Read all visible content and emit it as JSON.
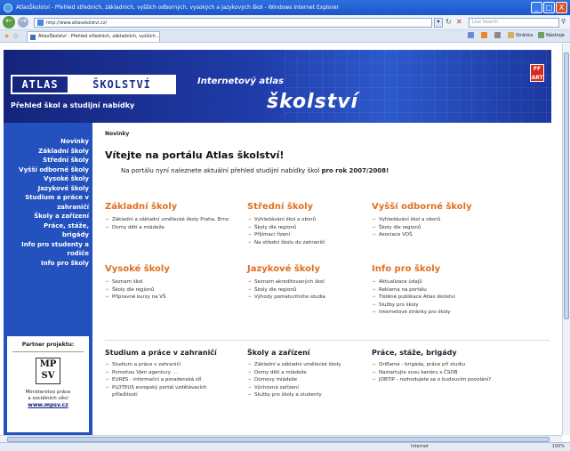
{
  "window": {
    "title": "AtlasŠkolství - Přehled středních, základních, vyšších odborných, vysokých a jazykových škol - Windows Internet Explorer",
    "minimize": "_",
    "maximize": "□",
    "close": "X"
  },
  "address_bar": {
    "url": "http://www.atlasskolstvi.cz/",
    "search_placeholder": "Live Search"
  },
  "tabs": [
    {
      "label": "AtlasŠkolství - Přehled středních, základních, vyšších..."
    }
  ],
  "toolbar": {
    "page_label": "Stránka",
    "tools_label": "Nástroje"
  },
  "banner": {
    "logo_left": "ATLAS",
    "logo_right": "ŠKOLSTVÍ",
    "subtitle": "Přehled škol a studijní nabídky",
    "tagline": "Internetový atlas",
    "big": "školství",
    "partner_logo": "FF ART"
  },
  "sidebar": {
    "items": [
      "Novinky",
      "Základní školy",
      "Střední školy",
      "Vyšší odborné školy",
      "Vysoké školy",
      "Jazykové školy",
      "Studium a práce v",
      "zahraničí",
      "Školy a zařízení",
      "Práce, stáže,",
      "brigády",
      "Info pro studenty a",
      "rodiče",
      "Info pro školy"
    ],
    "partner": {
      "heading": "Partner projektu:",
      "logo_top": "MP",
      "logo_bottom": "SV",
      "name_line1": "Ministerstvo práce",
      "name_line2": "a sociálních věcí",
      "link": "www.mpsv.cz"
    }
  },
  "main": {
    "breadcrumb": "Novinky",
    "welcome": "Vítejte na portálu Atlas školství!",
    "intro_pre": "Na portálu nyní naleznete aktuální přehled studijní nabídky škol",
    "intro_bold": "pro rok 2007/2008!",
    "sections": [
      {
        "title": "Základní školy",
        "items": [
          "Základní a základní umělecké školy Praha, Brno",
          "Domy dětí a mládeže"
        ]
      },
      {
        "title": "Střední školy",
        "items": [
          "Vyhledávání škol a oborů",
          "Školy dle regionů",
          "Přijímací řízení",
          "Na střední školu do zahraničí"
        ]
      },
      {
        "title": "Vyšší odborné školy",
        "items": [
          "Vyhledávání škol a oborů",
          "Školy dle regionů",
          "Asociace VOŠ"
        ]
      },
      {
        "title": "Vysoké školy",
        "items": [
          "Seznam škol",
          "Školy dle regionů",
          "Přípravné kurzy na VŠ"
        ]
      },
      {
        "title": "Jazykové školy",
        "items": [
          "Seznam akreditovaných škol",
          "Školy dle regionů",
          "Výhody pomaturitního studia"
        ]
      },
      {
        "title": "Info pro školy",
        "items": [
          "Aktualizace údajů",
          "Reklama na portálu",
          "Tištěné publikace Atlas školství",
          "Služby pro školy",
          "Internetové stránky pro školy"
        ]
      },
      {
        "title": "Studium a práce v zahraničí",
        "items": [
          "Studium a práce v zahraničí",
          "Pomohou Vám agentury ...",
          "EURES - informační a poradenská síť",
          "PLOTEUS evropský portál vzdělávacích příležitostí"
        ]
      },
      {
        "title": "Školy a zařízení",
        "items": [
          "Základní a základní umělecké školy",
          "Domy dětí a mládeže",
          "Domovy mládeže",
          "Výchovná zařízení",
          "Služby pro školy a studenty"
        ]
      },
      {
        "title": "Práce, stáže, brigády",
        "items": [
          "Oriflame - brigáda, práce při studiu",
          "Nastartujte svou kariéru s ČSOB",
          "JOBTIP - rozhodujete se o budoucím povolání?"
        ]
      }
    ]
  },
  "statusbar": {
    "zone": "Internet",
    "zoom": "100%"
  }
}
